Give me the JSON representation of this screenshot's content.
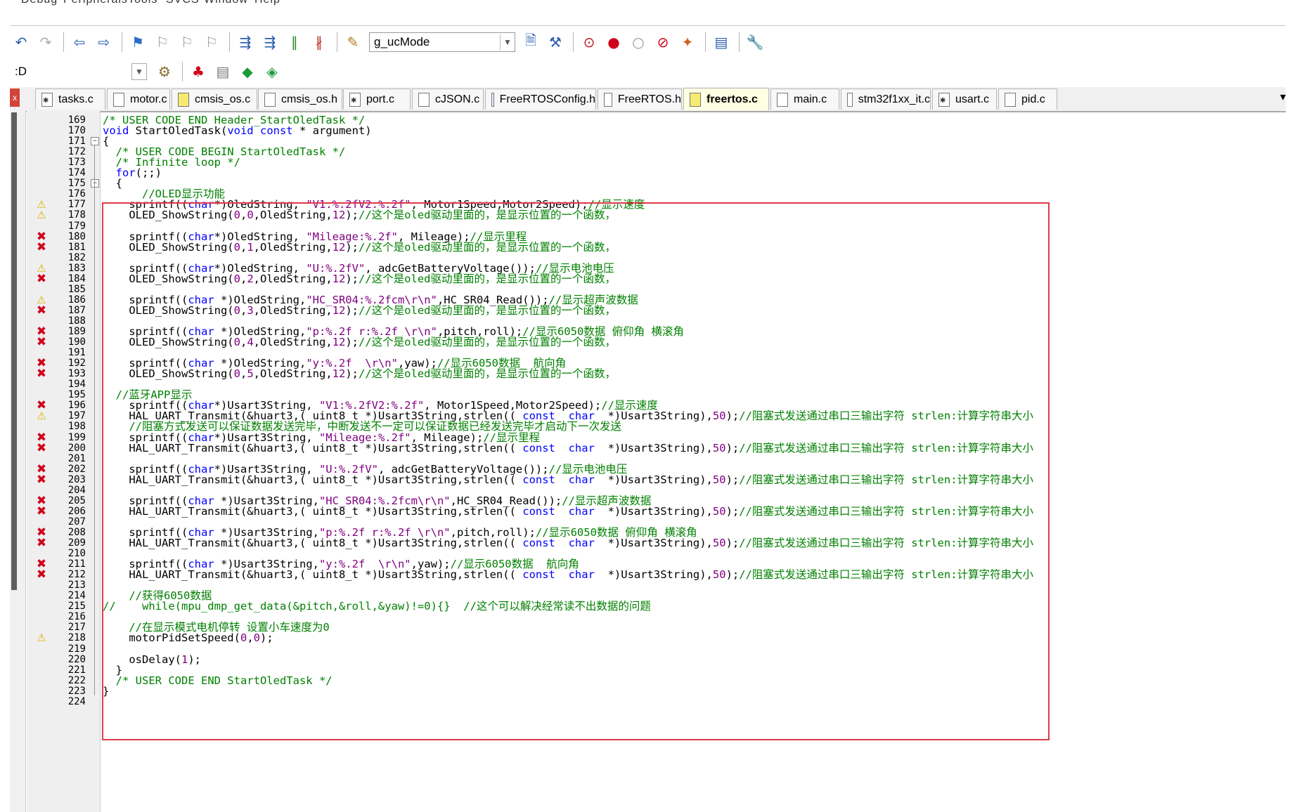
{
  "menu": [
    "Debug",
    "Peripherals",
    "Tools",
    "SVCS",
    "Window",
    "Help"
  ],
  "toolbar1": {
    "icons": [
      "undo-icon",
      "redo-icon",
      "nav-back-icon",
      "nav-forward-icon",
      "bookmark-set-icon",
      "bookmark-prev-icon",
      "bookmark-next-icon",
      "bookmark-clear-icon",
      "indent-icon",
      "unindent-icon",
      "comment-icon",
      "uncomment-icon",
      "find-in-files-icon"
    ],
    "symbol_combo": "g_ucMode",
    "icons_after": [
      "incremental-find-icon",
      "source-browser-icon",
      "debug-start-icon",
      "breakpoint-insert-icon",
      "breakpoint-disable-icon",
      "breakpoint-kill-icon",
      "breakpoint-enable-icon",
      "window-layout-icon",
      "configure-icon"
    ]
  },
  "toolbar2": {
    "target_combo": ":D",
    "icons": [
      "options-target-icon",
      "manage-components-icon",
      "pack-installer-icon",
      "select-packs-icon",
      "rte-icon"
    ]
  },
  "tabs": [
    {
      "label": "tasks.c",
      "icon": "c"
    },
    {
      "label": "motor.c",
      "icon": "h"
    },
    {
      "label": "cmsis_os.c",
      "icon": "yel"
    },
    {
      "label": "cmsis_os.h",
      "icon": "h"
    },
    {
      "label": "port.c",
      "icon": "c"
    },
    {
      "label": "cJSON.c",
      "icon": "h"
    },
    {
      "label": "FreeRTOSConfig.h",
      "icon": "cfg"
    },
    {
      "label": "FreeRTOS.h",
      "icon": "h"
    },
    {
      "label": "freertos.c",
      "icon": "yel",
      "active": true
    },
    {
      "label": "main.c",
      "icon": "h"
    },
    {
      "label": "stm32f1xx_it.c",
      "icon": "h"
    },
    {
      "label": "usart.c",
      "icon": "c"
    },
    {
      "label": "pid.c",
      "icon": "h"
    }
  ],
  "editor": {
    "lines": [
      {
        "n": "169",
        "m": "",
        "code": "/* USER CODE END Header_StartOledTask */"
      },
      {
        "n": "170",
        "m": "",
        "code": "void StartOledTask(void const * argument)"
      },
      {
        "n": "171",
        "m": "",
        "code": "{",
        "fold": "minus"
      },
      {
        "n": "172",
        "m": "",
        "code": "  /* USER CODE BEGIN StartOledTask */"
      },
      {
        "n": "173",
        "m": "",
        "code": "  /* Infinite loop */"
      },
      {
        "n": "174",
        "m": "",
        "code": "  for(;;)"
      },
      {
        "n": "175",
        "m": "",
        "code": "  {",
        "fold": "minus"
      },
      {
        "n": "176",
        "m": "",
        "code": "      //OLED显示功能"
      },
      {
        "n": "177",
        "m": "warn",
        "code": "    sprintf((char*)OledString, \"V1:%.2fV2:%.2f\", Motor1Speed,Motor2Speed);//显示速度"
      },
      {
        "n": "178",
        "m": "warn",
        "code": "    OLED_ShowString(0,0,OledString,12);//这个是oled驱动里面的，是显示位置的一个函数，"
      },
      {
        "n": "179",
        "m": "",
        "code": ""
      },
      {
        "n": "180",
        "m": "err",
        "code": "    sprintf((char*)OledString, \"Mileage:%.2f\", Mileage);//显示里程"
      },
      {
        "n": "181",
        "m": "err",
        "code": "    OLED_ShowString(0,1,OledString,12);//这个是oled驱动里面的，是显示位置的一个函数，"
      },
      {
        "n": "182",
        "m": "",
        "code": ""
      },
      {
        "n": "183",
        "m": "warn",
        "code": "    sprintf((char*)OledString, \"U:%.2fV\", adcGetBatteryVoltage());//显示电池电压"
      },
      {
        "n": "184",
        "m": "err",
        "code": "    OLED_ShowString(0,2,OledString,12);//这个是oled驱动里面的，是显示位置的一个函数，"
      },
      {
        "n": "185",
        "m": "",
        "code": ""
      },
      {
        "n": "186",
        "m": "warn",
        "code": "    sprintf((char *)OledString,\"HC_SR04:%.2fcm\\r\\n\",HC_SR04_Read());//显示超声波数据"
      },
      {
        "n": "187",
        "m": "err",
        "code": "    OLED_ShowString(0,3,OledString,12);//这个是oled驱动里面的，是显示位置的一个函数，"
      },
      {
        "n": "188",
        "m": "",
        "code": ""
      },
      {
        "n": "189",
        "m": "err",
        "code": "    sprintf((char *)OledString,\"p:%.2f r:%.2f \\r\\n\",pitch,roll);//显示6050数据 俯仰角 横滚角"
      },
      {
        "n": "190",
        "m": "err",
        "code": "    OLED_ShowString(0,4,OledString,12);//这个是oled驱动里面的，是显示位置的一个函数，"
      },
      {
        "n": "191",
        "m": "",
        "code": ""
      },
      {
        "n": "192",
        "m": "err",
        "code": "    sprintf((char *)OledString,\"y:%.2f  \\r\\n\",yaw);//显示6050数据  航向角"
      },
      {
        "n": "193",
        "m": "err",
        "code": "    OLED_ShowString(0,5,OledString,12);//这个是oled驱动里面的，是显示位置的一个函数，"
      },
      {
        "n": "194",
        "m": "",
        "code": ""
      },
      {
        "n": "195",
        "m": "",
        "code": "  //蓝牙APP显示"
      },
      {
        "n": "196",
        "m": "err",
        "code": "    sprintf((char*)Usart3String, \"V1:%.2fV2:%.2f\", Motor1Speed,Motor2Speed);//显示速度"
      },
      {
        "n": "197",
        "m": "warn",
        "code": "    HAL_UART_Transmit(&huart3,( uint8_t *)Usart3String,strlen(( const  char  *)Usart3String),50);//阻塞式发送通过串口三输出字符 strlen:计算字符串大小"
      },
      {
        "n": "198",
        "m": "",
        "code": "    //阻塞方式发送可以保证数据发送完毕，中断发送不一定可以保证数据已经发送完毕才启动下一次发送"
      },
      {
        "n": "199",
        "m": "err",
        "code": "    sprintf((char*)Usart3String, \"Mileage:%.2f\", Mileage);//显示里程"
      },
      {
        "n": "200",
        "m": "err",
        "code": "    HAL_UART_Transmit(&huart3,( uint8_t *)Usart3String,strlen(( const  char  *)Usart3String),50);//阻塞式发送通过串口三输出字符 strlen:计算字符串大小"
      },
      {
        "n": "201",
        "m": "",
        "code": ""
      },
      {
        "n": "202",
        "m": "err",
        "code": "    sprintf((char*)Usart3String, \"U:%.2fV\", adcGetBatteryVoltage());//显示电池电压"
      },
      {
        "n": "203",
        "m": "err",
        "code": "    HAL_UART_Transmit(&huart3,( uint8_t *)Usart3String,strlen(( const  char  *)Usart3String),50);//阻塞式发送通过串口三输出字符 strlen:计算字符串大小"
      },
      {
        "n": "204",
        "m": "",
        "code": ""
      },
      {
        "n": "205",
        "m": "err",
        "code": "    sprintf((char *)Usart3String,\"HC_SR04:%.2fcm\\r\\n\",HC_SR04_Read());//显示超声波数据"
      },
      {
        "n": "206",
        "m": "err",
        "code": "    HAL_UART_Transmit(&huart3,( uint8_t *)Usart3String,strlen(( const  char  *)Usart3String),50);//阻塞式发送通过串口三输出字符 strlen:计算字符串大小"
      },
      {
        "n": "207",
        "m": "",
        "code": ""
      },
      {
        "n": "208",
        "m": "err",
        "code": "    sprintf((char *)Usart3String,\"p:%.2f r:%.2f \\r\\n\",pitch,roll);//显示6050数据 俯仰角 横滚角"
      },
      {
        "n": "209",
        "m": "err",
        "code": "    HAL_UART_Transmit(&huart3,( uint8_t *)Usart3String,strlen(( const  char  *)Usart3String),50);//阻塞式发送通过串口三输出字符 strlen:计算字符串大小"
      },
      {
        "n": "210",
        "m": "",
        "code": ""
      },
      {
        "n": "211",
        "m": "err",
        "code": "    sprintf((char *)Usart3String,\"y:%.2f  \\r\\n\",yaw);//显示6050数据  航向角"
      },
      {
        "n": "212",
        "m": "err",
        "code": "    HAL_UART_Transmit(&huart3,( uint8_t *)Usart3String,strlen(( const  char  *)Usart3String),50);//阻塞式发送通过串口三输出字符 strlen:计算字符串大小"
      },
      {
        "n": "213",
        "m": "",
        "code": ""
      },
      {
        "n": "214",
        "m": "",
        "code": "    //获得6050数据"
      },
      {
        "n": "215",
        "m": "",
        "code": "//    while(mpu_dmp_get_data(&pitch,&roll,&yaw)!=0){}  //这个可以解决经常读不出数据的问题"
      },
      {
        "n": "216",
        "m": "",
        "code": ""
      },
      {
        "n": "217",
        "m": "",
        "code": "    //在显示模式电机停转 设置小车速度为0"
      },
      {
        "n": "218",
        "m": "warn",
        "code": "    motorPidSetSpeed(0,0);"
      },
      {
        "n": "219",
        "m": "",
        "code": ""
      },
      {
        "n": "220",
        "m": "",
        "code": "    osDelay(1);"
      },
      {
        "n": "221",
        "m": "",
        "code": "  }"
      },
      {
        "n": "222",
        "m": "",
        "code": "  /* USER CODE END StartOledTask */"
      },
      {
        "n": "223",
        "m": "",
        "code": "}"
      },
      {
        "n": "224",
        "m": "",
        "code": ""
      }
    ]
  },
  "colors": {
    "keyword": "#0000ff",
    "comment": "#008000",
    "number": "#800080",
    "string": "#800080",
    "error": "#d0021b",
    "warning": "#e0b000",
    "highlight_border": "#e03a4a",
    "active_tab": "#ffffe2"
  }
}
